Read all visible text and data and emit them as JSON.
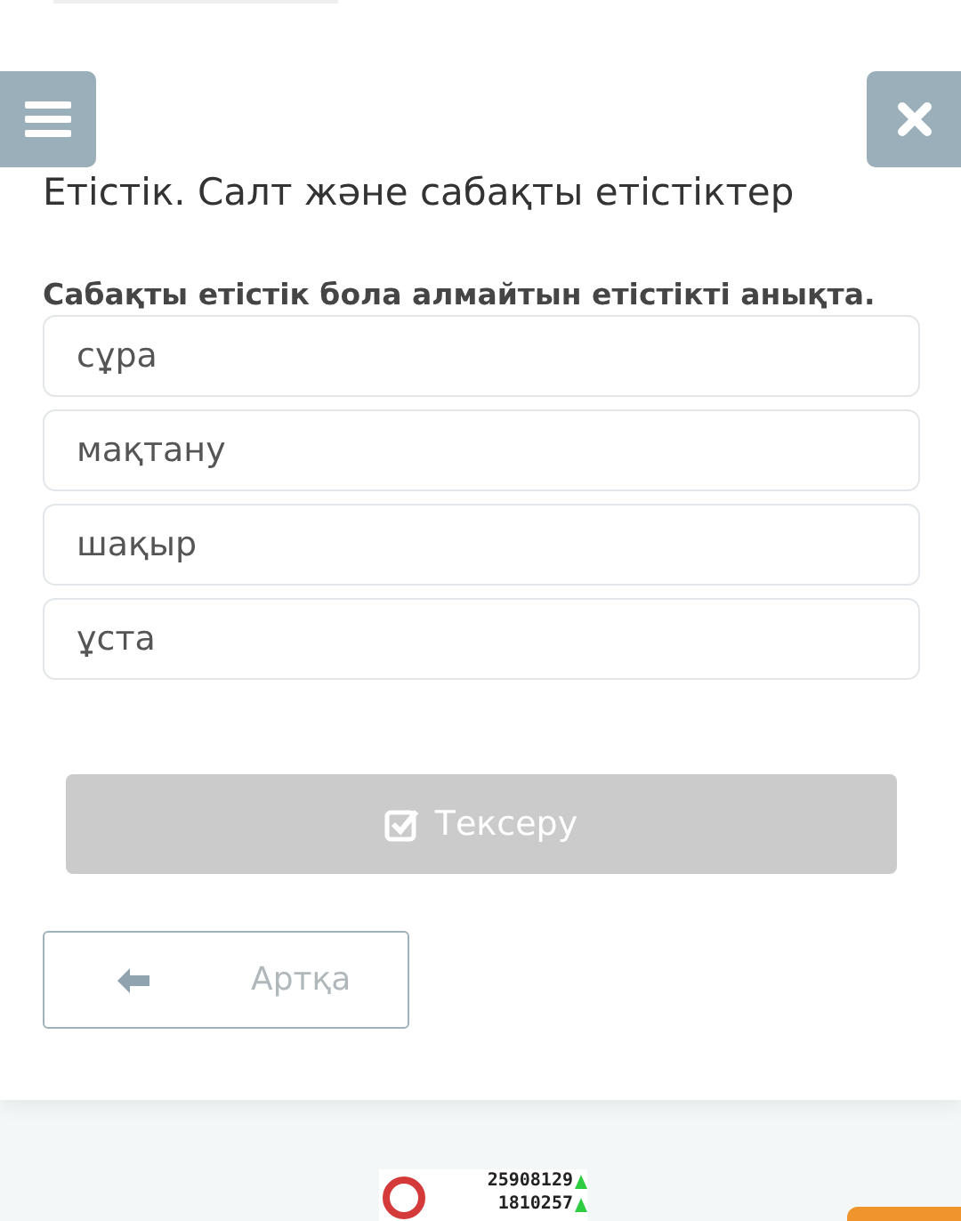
{
  "title": "Етістік. Салт және сабақты етістіктер",
  "question": "Сабақты етістік бола алмайтын етістікті анықта.",
  "options": [
    {
      "label": "сұра",
      "selected": false
    },
    {
      "label": "мақтану",
      "selected": false
    },
    {
      "label": "шақыр",
      "selected": false
    },
    {
      "label": "ұста",
      "selected": false
    }
  ],
  "check_button": {
    "label": "Тексеру",
    "disabled": true
  },
  "back_button": {
    "label": "Артқа"
  },
  "counter": {
    "line_1": "25908129",
    "line_2": "1810257"
  }
}
